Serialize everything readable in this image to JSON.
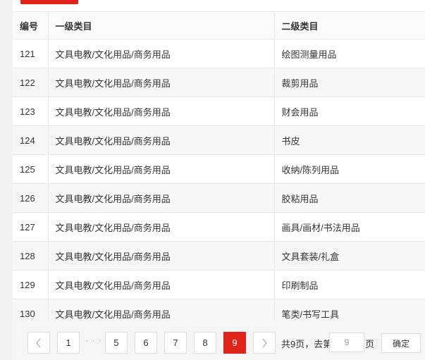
{
  "table": {
    "headers": [
      "编号",
      "一级类目",
      "二级类目"
    ],
    "rows": [
      {
        "id": "121",
        "level1": "文具电教/文化用品/商务用品",
        "level2": "绘图测量用品"
      },
      {
        "id": "122",
        "level1": "文具电教/文化用品/商务用品",
        "level2": "裁剪用品"
      },
      {
        "id": "123",
        "level1": "文具电教/文化用品/商务用品",
        "level2": "财会用品"
      },
      {
        "id": "124",
        "level1": "文具电教/文化用品/商务用品",
        "level2": "书皮"
      },
      {
        "id": "125",
        "level1": "文具电教/文化用品/商务用品",
        "level2": "收纳/陈列用品"
      },
      {
        "id": "126",
        "level1": "文具电教/文化用品/商务用品",
        "level2": "胶粘用品"
      },
      {
        "id": "127",
        "level1": "文具电教/文化用品/商务用品",
        "level2": "画具/画材/书法用品"
      },
      {
        "id": "128",
        "level1": "文具电教/文化用品/商务用品",
        "level2": "文具套装/礼盒"
      },
      {
        "id": "129",
        "level1": "文具电教/文化用品/商务用品",
        "level2": "印刷制品"
      },
      {
        "id": "130",
        "level1": "文具电教/文化用品/商务用品",
        "level2": "笔类/书写工具"
      }
    ]
  },
  "pagination": {
    "first": "1",
    "ellipsis": "· · ·",
    "pages": [
      "5",
      "6",
      "7",
      "8"
    ],
    "current": "9",
    "total_text": "共9页，去第",
    "goto_value": "9",
    "page_unit": "页",
    "confirm_label": "确定"
  },
  "colors": {
    "accent": "#e2231a",
    "row_alt": "#f7f7f7",
    "border": "#e8e8e8"
  },
  "icons": {
    "prev": "chevron-left-icon",
    "next": "chevron-right-icon"
  }
}
